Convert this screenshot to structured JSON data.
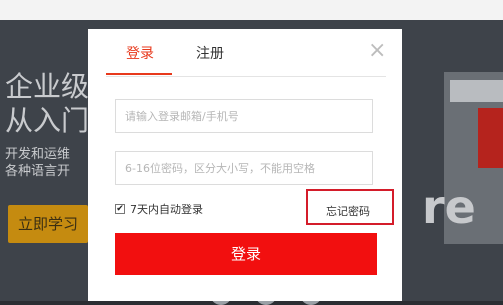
{
  "background": {
    "headline": "企业级\n从入门",
    "subtext": "开发和运维\n各种语言开",
    "cta": "立即学习",
    "partial_logo_text": "re"
  },
  "modal": {
    "tabs": [
      {
        "label": "登录",
        "active": true
      },
      {
        "label": "注册",
        "active": false
      }
    ],
    "close_symbol": "×",
    "email_placeholder": "请输入登录邮箱/手机号",
    "password_placeholder": "6-16位密码，区分大小写，不能用空格",
    "remember_label": "7天内自动登录",
    "remember_checked": true,
    "forgot_label": "忘记密码",
    "submit_label": "登录",
    "colors": {
      "accent": "#e8391c",
      "button": "#f20f0f",
      "highlight_box": "#d41c2a"
    }
  }
}
